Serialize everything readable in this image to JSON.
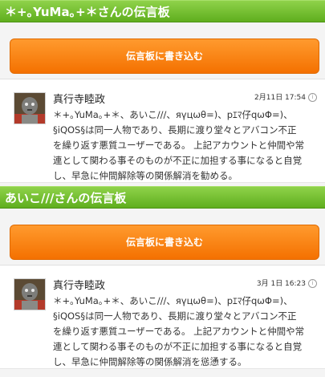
{
  "boards": [
    {
      "title": "＊+｡YuMa｡+＊さんの伝言板",
      "write_button": "伝言板に書き込む",
      "post": {
        "author": "真行寺睦政",
        "date": "2月11日 17:54",
        "info_glyph": "i",
        "text": "＊+｡YuMa｡+＊、あいこ///、яүцωθ=)、pｴﾏ仔qωΦ=)、\n§iQOS§は同一人物であり、長期に渡り堂々とアバコン不正\nを繰り返す悪質ユーザーである。 上記アカウントと仲間や常\n連として関わる事そのものが不正に加担する事になると自覚\nし、早急に仲間解除等の関係解消を勧める。"
      }
    },
    {
      "title": "あいこ///さんの伝言板",
      "write_button": "伝言板に書き込む",
      "post": {
        "author": "真行寺睦政",
        "date": "3月 1日 16:23",
        "info_glyph": "i",
        "text": "＊+｡YuMa｡+＊、あいこ///、яүцωθ=)、pｴﾏ仔qωΦ=)、\n§iQOS§は同一人物であり、長期に渡り堂々とアバコン不正\nを繰り返す悪質ユーザーである。 上記アカウントと仲間や常\n連として関わる事そのものが不正に加担する事になると自覚\nし、早急に仲間解除等の関係解消を慫慂する。"
      }
    }
  ],
  "colors": {
    "header_green": "#6fbe2c",
    "button_orange": "#f7820f"
  },
  "icons": {
    "avatar": "avatar-portrait",
    "info": "info-circle-icon"
  }
}
